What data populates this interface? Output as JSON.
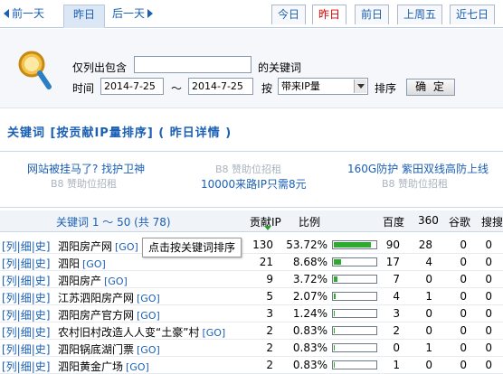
{
  "nav": {
    "prev_label": "前一天",
    "current_label": "昨日",
    "next_label": "后一天",
    "quick": [
      "今日",
      "昨日",
      "前日",
      "上周五",
      "近七日"
    ]
  },
  "search": {
    "include_label": "仅列出包含",
    "keyword_value": "",
    "keyword_suffix": "的关键词",
    "time_label": "时间",
    "date_from": "2014-7-25",
    "tilde": "～",
    "date_to": "2014-7-25",
    "sort_by_label": "按",
    "sort_value": "带来IP量",
    "sort_label": "排序",
    "confirm_label": "确 定"
  },
  "section_title": "关键词 [按贡献IP量排序] ( 昨日详情 )",
  "ads": {
    "a1": "网站被挂马了? 找护卫神",
    "a2": "B8 赞助位招租",
    "a3": "160G防护 紫田双线高防上线",
    "a4": "B8 赞助位招租",
    "a5": "10000来路IP只需8元",
    "a6": "B8 赞助位招租"
  },
  "table": {
    "header": {
      "keywords": "关键词 1 ～ 50 (共 78)",
      "ip": "贡献IP",
      "ratio": "比例",
      "baidu": "百度",
      "s360": "360",
      "google": "谷歌",
      "sogou": "搜搜"
    },
    "rows": [
      {
        "links": "[列|细|史]",
        "kw": "泗阳房产网",
        "go": "[GO]",
        "ip": "130",
        "pct": "53.72%",
        "frac": 0.9,
        "bd": "90",
        "s360": "28",
        "gg": "0",
        "sg": "0"
      },
      {
        "links": "[列|细|史]",
        "kw": "泗阳",
        "go": "[GO]",
        "ip": "21",
        "pct": "8.68%",
        "frac": 0.18,
        "bd": "17",
        "s360": "4",
        "gg": "0",
        "sg": "0"
      },
      {
        "links": "[列|细|史]",
        "kw": "泗阳房产",
        "go": "[GO]",
        "ip": "9",
        "pct": "3.72%",
        "frac": 0.08,
        "bd": "7",
        "s360": "0",
        "gg": "0",
        "sg": "0"
      },
      {
        "links": "[列|细|史]",
        "kw": "江苏泗阳房产网",
        "go": "[GO]",
        "ip": "5",
        "pct": "2.07%",
        "frac": 0.05,
        "bd": "4",
        "s360": "1",
        "gg": "0",
        "sg": "0"
      },
      {
        "links": "[列|细|史]",
        "kw": "泗阳房产官方网",
        "go": "[GO]",
        "ip": "3",
        "pct": "1.24%",
        "frac": 0.03,
        "bd": "3",
        "s360": "0",
        "gg": "0",
        "sg": "0"
      },
      {
        "links": "[列|细|史]",
        "kw": "农村旧村改造人人变“土豪”村",
        "go": "[GO]",
        "ip": "2",
        "pct": "0.83%",
        "frac": 0.02,
        "bd": "2",
        "s360": "0",
        "gg": "0",
        "sg": "0"
      },
      {
        "links": "[列|细|史]",
        "kw": "泗阳锅底湖门票",
        "go": "[GO]",
        "ip": "2",
        "pct": "0.83%",
        "frac": 0.02,
        "bd": "0",
        "s360": "1",
        "gg": "0",
        "sg": "0"
      },
      {
        "links": "[列|细|史]",
        "kw": "泗阳黄金广场",
        "go": "[GO]",
        "ip": "2",
        "pct": "0.83%",
        "frac": 0.02,
        "bd": "1",
        "s360": "0",
        "gg": "0",
        "sg": "0"
      }
    ]
  },
  "tooltip": "点击按关键词排序",
  "colors": {
    "link": "#1a5fb4",
    "accent": "#dd0000",
    "bar": "#2eaa2e"
  }
}
